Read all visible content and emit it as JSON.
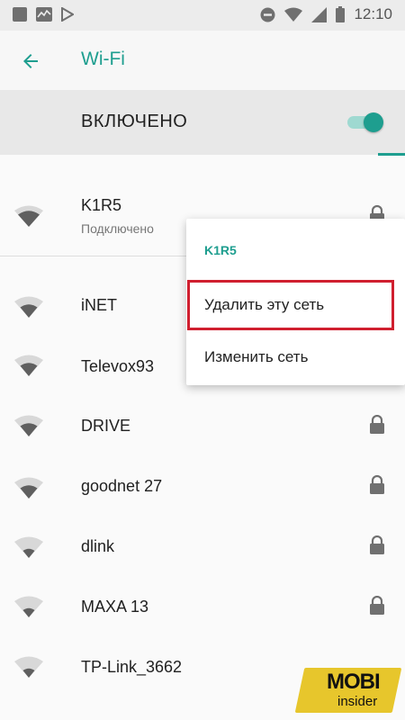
{
  "status_bar": {
    "time": "12:10",
    "left_icons": [
      "notification-square-icon",
      "pulse-chart-icon",
      "play-store-icon"
    ],
    "right_icons": [
      "do-not-disturb-icon",
      "wifi-signal-icon",
      "cell-signal-icon",
      "battery-icon"
    ]
  },
  "app_bar": {
    "back_icon": "arrow-left-icon",
    "title": "Wi-Fi"
  },
  "master_switch": {
    "label": "ВКЛЮЧЕНО",
    "on": true
  },
  "networks": [
    {
      "name": "K1R5",
      "status": "Подключено",
      "secured": true,
      "signal": 3
    },
    {
      "name": "iNET",
      "status": "",
      "secured": true,
      "signal": 2
    },
    {
      "name": "Televox93",
      "status": "",
      "secured": true,
      "signal": 2
    },
    {
      "name": "DRIVE",
      "status": "",
      "secured": true,
      "signal": 2
    },
    {
      "name": "goodnet 27",
      "status": "",
      "secured": true,
      "signal": 2
    },
    {
      "name": "dlink",
      "status": "",
      "secured": true,
      "signal": 1
    },
    {
      "name": "MAXA 13",
      "status": "",
      "secured": true,
      "signal": 1
    },
    {
      "name": "TP-Link_3662",
      "status": "",
      "secured": true,
      "signal": 1
    }
  ],
  "context_menu": {
    "title": "K1R5",
    "items": [
      {
        "label": "Удалить эту сеть",
        "highlighted": true
      },
      {
        "label": "Изменить сеть",
        "highlighted": false
      }
    ]
  },
  "watermark": {
    "brand": "MOBI",
    "sub": "insider"
  },
  "colors": {
    "accent": "#1e9e8f",
    "highlight_border": "#d01f2f",
    "watermark_bg": "#e7c62c"
  }
}
